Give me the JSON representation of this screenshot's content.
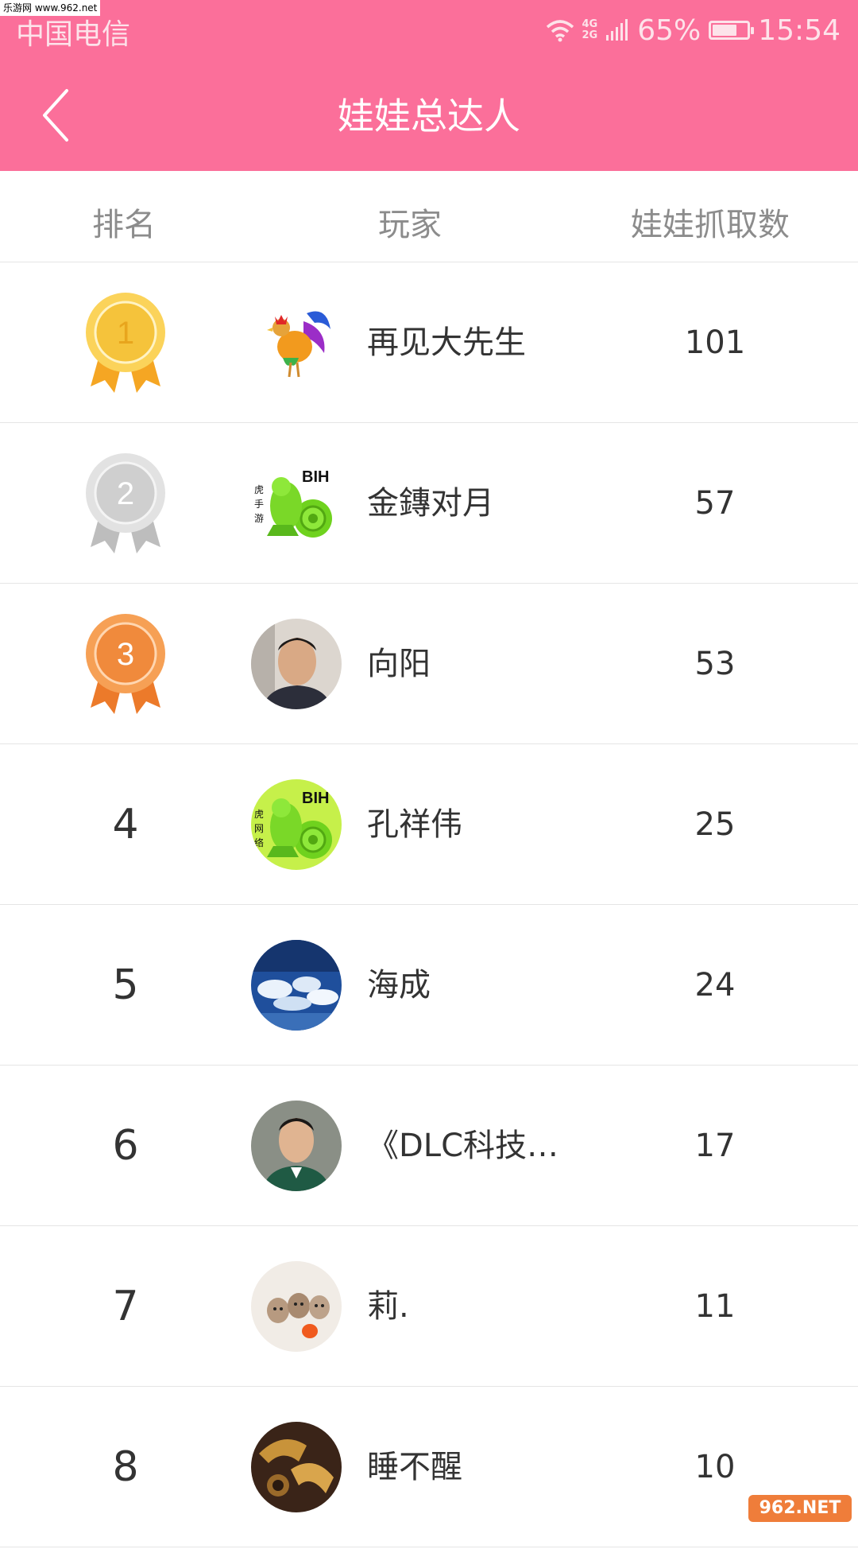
{
  "status_bar": {
    "watermark": "乐游网 www.962.net",
    "carrier": "中国电信",
    "network_top": "4G",
    "network_bottom": "2G",
    "battery_percent": "65%",
    "battery_level": 0.65,
    "time": "15:54"
  },
  "header": {
    "title": "娃娃总达人",
    "back_icon": "chevron-left-icon",
    "color": "#fb6f9a"
  },
  "columns": {
    "rank": "排名",
    "player": "玩家",
    "count": "娃娃抓取数"
  },
  "rows": [
    {
      "rank": "1",
      "name": "再见大先生",
      "count": "101",
      "medal": "gold-medal-icon",
      "avatar": "rooster-avatar"
    },
    {
      "rank": "2",
      "name": "金鏄对月",
      "count": "57",
      "medal": "silver-medal-icon",
      "avatar": "green-chameleon-avatar"
    },
    {
      "rank": "3",
      "name": "向阳",
      "count": "53",
      "medal": "bronze-medal-icon",
      "avatar": "man-photo-avatar"
    },
    {
      "rank": "4",
      "name": "孔祥伟",
      "count": "25",
      "avatar": "green-chameleon-avatar"
    },
    {
      "rank": "5",
      "name": "海成",
      "count": "24",
      "avatar": "sky-clouds-avatar"
    },
    {
      "rank": "6",
      "name": "《DLC科技…",
      "count": "17",
      "avatar": "man-photo-avatar"
    },
    {
      "rank": "7",
      "name": "莉.",
      "count": "11",
      "avatar": "kittens-avatar"
    },
    {
      "rank": "8",
      "name": "睡不醒",
      "count": "10",
      "avatar": "brass-avatar"
    }
  ],
  "watermark_bottom": "962.NET 乐游网",
  "colors": {
    "gold": "#f5c33b",
    "silver": "#cfcfcf",
    "bronze": "#f08a3c"
  }
}
